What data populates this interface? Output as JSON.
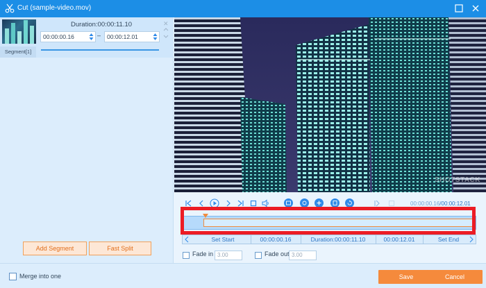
{
  "window": {
    "title": "Cut (sample-video.mov)"
  },
  "segment": {
    "label": "Segment[1]",
    "duration": "Duration:00:00:11.10",
    "start": "00:00:00.16",
    "end": "00:00:12.01",
    "separator": "–"
  },
  "left_buttons": {
    "add_segment": "Add Segment",
    "fast_split": "Fast Split"
  },
  "video": {
    "watermark": "SHOTSTACK"
  },
  "playback": {
    "current": "00:00:00.16",
    "total": "/00:00:12.01"
  },
  "trim": {
    "set_start": "Set Start",
    "start": "00:00:00.16",
    "duration": "Duration:00:00:11.10",
    "end": "00:00:12.01",
    "set_end": "Set End"
  },
  "fade": {
    "fade_in_label": "Fade in",
    "fade_in_value": "3.00",
    "fade_out_label": "Fade out",
    "fade_out_value": "3.00"
  },
  "footer": {
    "merge_label": "Merge into one",
    "save": "Save",
    "cancel": "Cancel"
  },
  "colors": {
    "title_bar": "#1c8ee6",
    "accent_orange": "#f58a3c",
    "highlight_red": "#ec1c24"
  }
}
